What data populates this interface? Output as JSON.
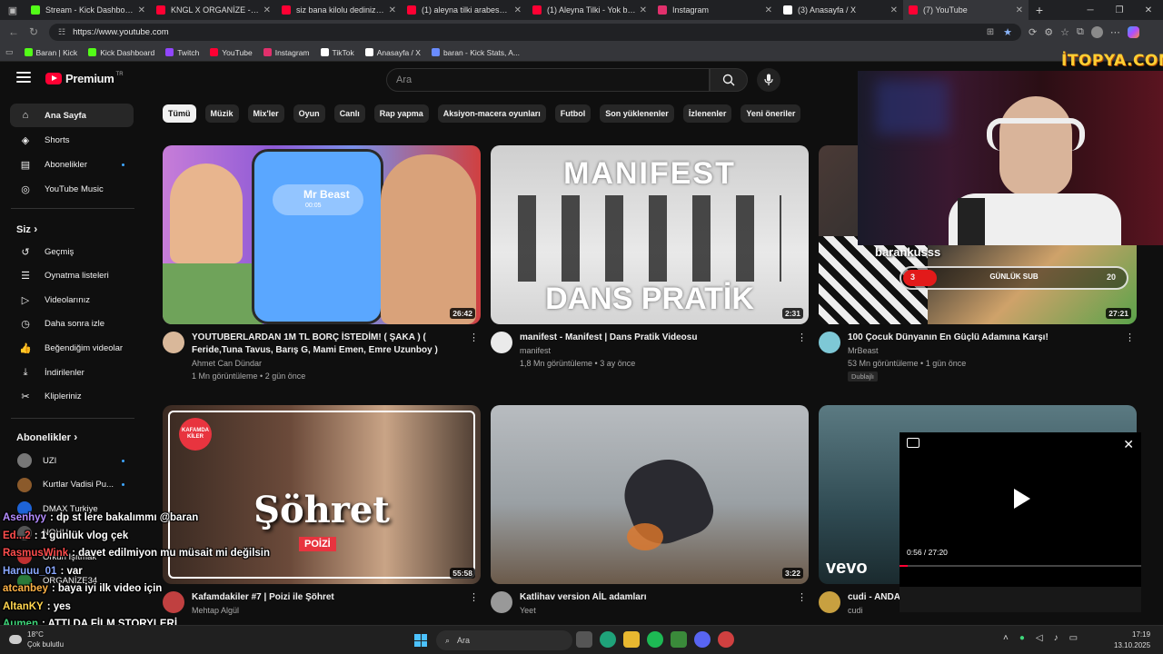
{
  "browser": {
    "tabs": [
      {
        "label": "Stream - Kick Dashboard",
        "color": "#53fc18",
        "active": false
      },
      {
        "label": "KNGL X ORGANİZE - KATLİ",
        "color": "#ff0033",
        "active": false
      },
      {
        "label": "siz bana kilolu dediniz diye",
        "color": "#ff0033",
        "active": false
      },
      {
        "label": "(1) aleyna tilki arabesk - You",
        "color": "#ff0033",
        "active": false
      },
      {
        "label": "(1) Aleyna Tilki - Yok bir şey",
        "color": "#ff0033",
        "active": false
      },
      {
        "label": "Instagram",
        "color": "#e1306c",
        "active": false
      },
      {
        "label": "(3) Anasayfa / X",
        "color": "#ffffff",
        "active": false
      },
      {
        "label": "(7) YouTube",
        "color": "#ff0033",
        "active": true
      }
    ],
    "url": "https://www.youtube.com",
    "bookmarks": [
      {
        "label": "Baran | Kick",
        "color": "#53fc18"
      },
      {
        "label": "Kick Dashboard",
        "color": "#53fc18"
      },
      {
        "label": "Twitch",
        "color": "#9146ff"
      },
      {
        "label": "YouTube",
        "color": "#ff0033"
      },
      {
        "label": "Instagram",
        "color": "#e1306c"
      },
      {
        "label": "TikTok",
        "color": "#ffffff"
      },
      {
        "label": "Anasayfa / X",
        "color": "#ffffff"
      },
      {
        "label": "baran - Kick Stats, A...",
        "color": "#6a8cff"
      }
    ]
  },
  "youtube": {
    "logo_text": "Premium",
    "logo_region": "TR",
    "search_placeholder": "Ara",
    "sidebar": {
      "main": [
        {
          "label": "Ana Sayfa",
          "icon": "home-icon",
          "glyph": "⌂"
        },
        {
          "label": "Shorts",
          "icon": "shorts-icon",
          "glyph": "◈"
        },
        {
          "label": "Abonelikler",
          "icon": "subscriptions-icon",
          "glyph": "▤"
        },
        {
          "label": "YouTube Music",
          "icon": "music-icon",
          "glyph": "◎"
        }
      ],
      "you_heading": "Siz",
      "you_items": [
        {
          "label": "Geçmiş",
          "icon": "history-icon",
          "glyph": "↺"
        },
        {
          "label": "Oynatma listeleri",
          "icon": "playlists-icon",
          "glyph": "☰"
        },
        {
          "label": "Videolarınız",
          "icon": "your-videos-icon",
          "glyph": "▷"
        },
        {
          "label": "Daha sonra izle",
          "icon": "watch-later-icon",
          "glyph": "◷"
        },
        {
          "label": "Beğendiğim videolar",
          "icon": "like-icon",
          "glyph": "👍"
        },
        {
          "label": "İndirilenler",
          "icon": "download-icon",
          "glyph": "⤓"
        },
        {
          "label": "Klipleriniz",
          "icon": "clips-icon",
          "glyph": "✂"
        }
      ],
      "subs_heading": "Abonelikler",
      "subs": [
        {
          "label": "UZI",
          "color": "#777777"
        },
        {
          "label": "Kurtlar Vadisi Pu...",
          "color": "#8b5a2b"
        },
        {
          "label": "DMAX Turkiye",
          "color": "#1e63d6"
        },
        {
          "label": "NOHU",
          "color": "#555555"
        },
        {
          "label": "Orkun Işıtmak",
          "color": "#c03030"
        },
        {
          "label": "ORGANİZE34",
          "color": "#2a7a3a"
        }
      ]
    },
    "chips": [
      "Tümü",
      "Müzik",
      "Mix'ler",
      "Oyun",
      "Canlı",
      "Rap yapma",
      "Aksiyon-macera oyunları",
      "Futbol",
      "Son yüklenenler",
      "İzlenenler",
      "Yeni öneriler"
    ],
    "videos": [
      {
        "title": "YOUTUBERLARDAN 1M TL BORÇ İSTEDİM! ( ŞAKA ) ( Feride,Tuna Tavus, Barış G, Mami Emen, Emre Uzunboy )",
        "channel": "Ahmet Can Dündar",
        "stats": "1 Mn görüntüleme • 2 gün önce",
        "duration": "26:42",
        "thumb_text": "Mr Beast",
        "thumb_sub": "00:05"
      },
      {
        "title": "manifest - Manifest | Dans Pratik Videosu",
        "channel": "manifest",
        "stats": "1,8 Mn görüntüleme • 3 ay önce",
        "duration": "2:31",
        "thumb_text": "MANIFEST",
        "thumb_sub": "DANS PRATİK"
      },
      {
        "title": "100 Çocuk Dünyanın En Güçlü Adamına Karşı!",
        "channel": "MrBeast",
        "stats": "53 Mn görüntüleme • 1 gün önce",
        "duration": "27:21",
        "badge": "Dublajlı"
      },
      {
        "title": "Kafamdakiler #7 | Poizi ile Şöhret",
        "channel": "Mehtap Algül",
        "stats": "",
        "duration": "55:58",
        "thumb_text": "Şöhret",
        "thumb_sub": "POİZİ",
        "thumb_tag": "KAFAMDA KİLER"
      },
      {
        "title": "Katlihav version AİL adamları",
        "channel": "Yeet",
        "stats": "",
        "duration": "3:22"
      },
      {
        "title": "cudi - ANDA",
        "channel": "cudi",
        "stats": "",
        "duration": "",
        "thumb_text": "vevo"
      }
    ],
    "miniplayer": {
      "time": "0:56 / 27:20",
      "progress": 0.034
    }
  },
  "overlay": {
    "watermark": "İTOPYA.COM",
    "streamer": "barankusss",
    "sub_goal": {
      "label": "GÜNLÜK SUB",
      "current": "3",
      "target": "20",
      "fraction": 0.15
    },
    "chat": [
      {
        "user": "Asenhyy",
        "msg": ": dp st lere bakalımmı @baran",
        "color": "#b48cff"
      },
      {
        "user": "Ed...2",
        "msg": ": 1 günlük vlog çek",
        "color": "#ff4d4d"
      },
      {
        "user": "RasmusWink",
        "msg": ": davet edilmiyon mu müsait mi değilsin",
        "color": "#ff4d4d"
      },
      {
        "user": "Haruuu_01",
        "msg": ": var",
        "color": "#8aa8ff"
      },
      {
        "user": "atcanbey",
        "msg": ": baya iyi ilk video için",
        "color": "#ffb347"
      },
      {
        "user": "AltanKY",
        "msg": ": yes",
        "color": "#ffd54f"
      },
      {
        "user": "Aumen",
        "msg": ": ATTI DA FİLM STORYLERİ",
        "color": "#3fd67a"
      }
    ]
  },
  "taskbar": {
    "weather_temp": "18°C",
    "weather_desc": "Çok bulutlu",
    "search": "Ara",
    "time": "17:19",
    "date": "13.10.2025"
  }
}
